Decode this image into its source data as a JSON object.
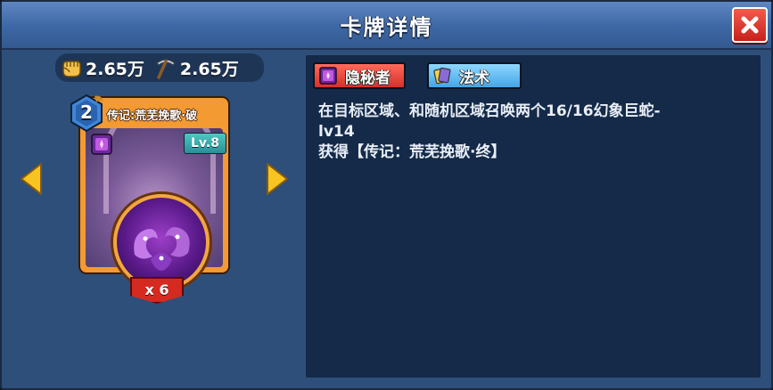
{
  "dialog": {
    "title": "卡牌详情"
  },
  "costs": [
    {
      "icon": "fist-icon",
      "value": "2.65万"
    },
    {
      "icon": "pickaxe-icon",
      "value": "2.65万"
    }
  ],
  "card": {
    "cost": "2",
    "name": "传记:荒芜挽歌·破",
    "level": "Lv.8",
    "count": "x 6",
    "frame_color": "#f49a32"
  },
  "tags": [
    {
      "label": "隐秘者",
      "icon": "secret-book-icon",
      "color": "#d8302a"
    },
    {
      "label": "法术",
      "icon": "spell-cards-icon",
      "color": "#44a6e6"
    }
  ],
  "description": {
    "line1": "在目标区域、和随机区域召唤两个16/16幻象巨蛇-",
    "line2": "lv14",
    "line3": "获得【传记：荒芜挽歌·终】"
  }
}
